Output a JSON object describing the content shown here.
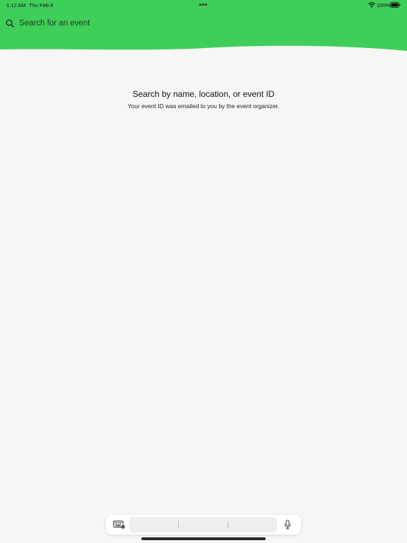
{
  "colors": {
    "header_green": "#3ecf5a",
    "background": "#f6f6f6"
  },
  "status_bar": {
    "time": "1:12 AM",
    "date": "Thu Feb 8",
    "battery": "100%",
    "icons": [
      "wifi-icon",
      "battery-icon",
      "multitasking-dots-icon"
    ]
  },
  "search": {
    "placeholder": "Search for an event",
    "icon": "search-icon"
  },
  "empty_state": {
    "title": "Search by name, location, or event ID",
    "subtitle": "Your event ID was emailed to you by the event organizer."
  },
  "keyboard_toolbar": {
    "icons": [
      "keyboard-icon",
      "microphone-icon"
    ]
  }
}
